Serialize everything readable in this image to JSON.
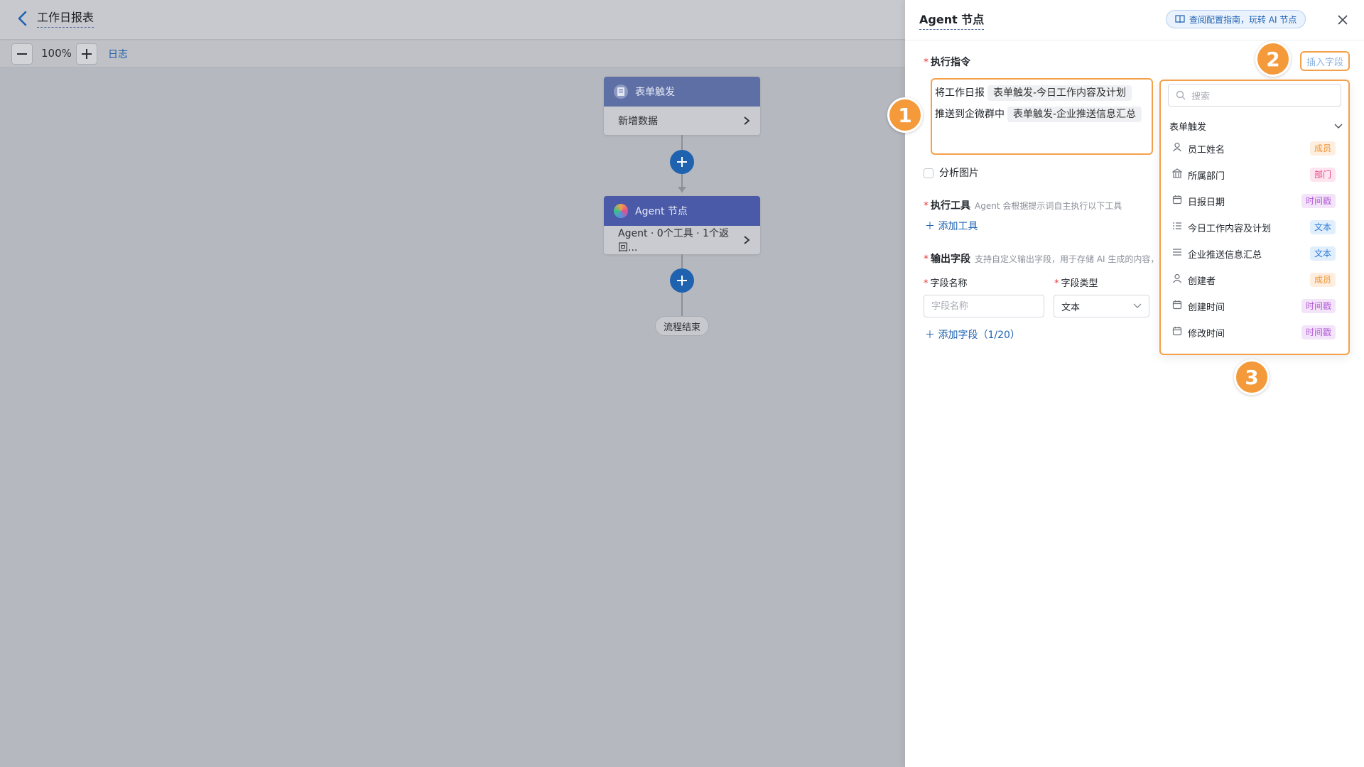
{
  "header": {
    "title": "工作日报表"
  },
  "zoom": {
    "level": "100%",
    "log_label": "日志"
  },
  "flow": {
    "trigger": {
      "title": "表单触发",
      "subtitle": "新增数据",
      "head_color": "#5d6fa4"
    },
    "agent": {
      "title": "Agent 节点",
      "subtitle": "Agent · 0个工具 · 1个返回...",
      "head_color": "#4a5aa8"
    },
    "end_label": "流程结束"
  },
  "panel": {
    "title": "Agent 节点",
    "guide_label": "查阅配置指南，玩转 AI 节点",
    "instruction": {
      "label": "执行指令",
      "line1_text": "将工作日报",
      "line1_tag": "表单触发-今日工作内容及计划",
      "line2_text": "推送到企微群中",
      "line2_tag": "表单触发-企业推送信息汇总"
    },
    "analyze_image_label": "分析图片",
    "tools": {
      "label": "执行工具",
      "hint": "Agent 会根据提示词自主执行以下工具",
      "add_label": "添加工具"
    },
    "output": {
      "label": "输出字段",
      "hint": "支持自定义输出字段，用于存储 AI 生成的内容，",
      "name_label": "字段名称",
      "type_label": "字段类型",
      "name_placeholder": "字段名称",
      "type_value": "文本",
      "add_label": "添加字段（1/20）"
    },
    "insert_label": "插入字段",
    "dropdown": {
      "search_placeholder": "搜索",
      "group": "表单触发",
      "items": [
        {
          "label": "员工姓名",
          "badge": "成员",
          "icon": "person-icon"
        },
        {
          "label": "所属部门",
          "badge": "部门",
          "icon": "building-icon"
        },
        {
          "label": "日报日期",
          "badge": "时间戳",
          "icon": "calendar-icon"
        },
        {
          "label": "今日工作内容及计划",
          "badge": "文本",
          "icon": "list-icon"
        },
        {
          "label": "企业推送信息汇总",
          "badge": "文本",
          "icon": "lines-icon"
        },
        {
          "label": "创建者",
          "badge": "成员",
          "icon": "person-icon"
        },
        {
          "label": "创建时间",
          "badge": "时间戳",
          "icon": "calendar-icon"
        },
        {
          "label": "修改时间",
          "badge": "时间戳",
          "icon": "calendar-icon"
        }
      ]
    }
  },
  "steps": [
    "1",
    "2",
    "3"
  ],
  "colors": {
    "accent": "#1f62b0",
    "highlight": "#f4a04a"
  }
}
